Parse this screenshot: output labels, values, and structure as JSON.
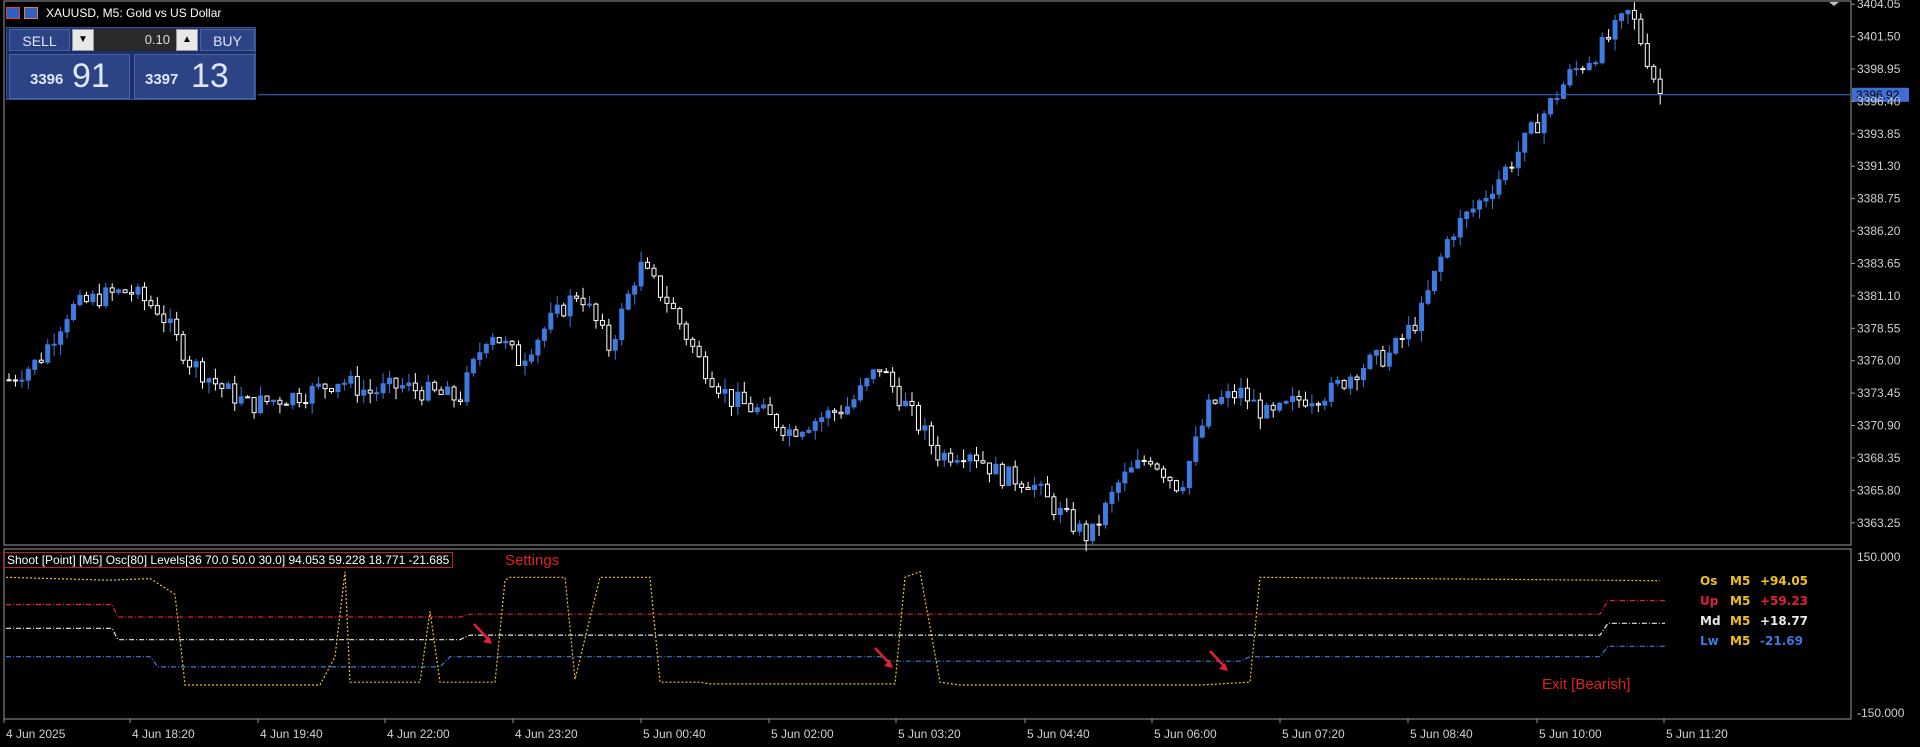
{
  "window": {
    "symbol_title": "XAUUSD, M5:  Gold vs US Dollar"
  },
  "trade_panel": {
    "sell_label": "SELL",
    "buy_label": "BUY",
    "lot_value": "0.10",
    "bid_small": "3396",
    "bid_big": "91",
    "ask_small": "3397",
    "ask_big": "13"
  },
  "colors": {
    "background": "#000000",
    "bull_candle": "#3d7be0",
    "bear_candle": "#ffffff",
    "current_price_line": "#3d6fd6",
    "osc": "#f0c020",
    "up": "#e0203c",
    "md": "#e8e8e8",
    "lw": "#3d7be0"
  },
  "indicator": {
    "label": "Shoot [Point] [M5]  Osc[80]  Levels[36 70.0 50.0 30.0] 94.053 59.228 18.771 -21.685",
    "settings_label": "Settings",
    "exit_label": "Exit [Bearish]",
    "legend": [
      {
        "name": "Os",
        "tf": "M5",
        "value": "+94.05",
        "color": "#f0c020"
      },
      {
        "name": "Up",
        "tf": "M5",
        "value": "+59.23",
        "color": "#e0203c"
      },
      {
        "name": "Md",
        "tf": "M5",
        "value": "+18.77",
        "color": "#e8e8e8"
      },
      {
        "name": "Lw",
        "tf": "M5",
        "value": "-21.69",
        "color": "#3d7be0"
      }
    ]
  },
  "chart_data": [
    {
      "type": "candlestick",
      "symbol": "XAUUSD",
      "timeframe": "M5",
      "y_ticks": [
        "3404.05",
        "3401.50",
        "3398.95",
        "3396.40",
        "3393.85",
        "3391.30",
        "3388.75",
        "3386.20",
        "3383.65",
        "3381.10",
        "3378.55",
        "3376.00",
        "3373.45",
        "3370.90",
        "3368.35",
        "3365.80",
        "3363.25"
      ],
      "ylim": [
        3361.5,
        3404.3
      ],
      "current_price": "3396.92",
      "x_ticks": [
        "4 Jun 2025",
        "4 Jun 18:20",
        "4 Jun 19:40",
        "4 Jun 22:00",
        "4 Jun 23:20",
        "5 Jun 00:40",
        "5 Jun 02:00",
        "5 Jun 03:20",
        "5 Jun 04:40",
        "5 Jun 06:00",
        "5 Jun 07:20",
        "5 Jun 08:40",
        "5 Jun 10:00",
        "5 Jun 11:20"
      ],
      "close_path": [
        3374.5,
        3376.0,
        3380.0,
        3381.0,
        3381.5,
        3380.0,
        3376.0,
        3374.0,
        3372.5,
        3373.0,
        3373.5,
        3374.5,
        3373.5,
        3374.0,
        3373.5,
        3373.0,
        3378.5,
        3376.0,
        3379.0,
        3381.5,
        3377.0,
        3383.5,
        3380.5,
        3376.0,
        3373.0,
        3372.0,
        3370.5,
        3371.5,
        3372.5,
        3375.5,
        3372.0,
        3368.5,
        3369.0,
        3367.0,
        3366.5,
        3364.0,
        3362.0,
        3366.5,
        3368.5,
        3366.0,
        3372.5,
        3373.5,
        3371.5,
        3373.0,
        3373.5,
        3375.5,
        3376.5,
        3379.5,
        3386.0,
        3388.5,
        3391.5,
        3395.0,
        3398.5,
        3400.5,
        3403.5,
        3397.0
      ]
    },
    {
      "type": "line",
      "name": "Shoot [Point] [M5]",
      "y_ticks": [
        "150.000",
        "-150.000"
      ],
      "ylim": [
        -150,
        150
      ],
      "levels": [
        70.0,
        50.0,
        30.0
      ],
      "series": [
        {
          "name": "Os",
          "last": 94.053
        },
        {
          "name": "Up",
          "last": 59.228
        },
        {
          "name": "Md",
          "last": 18.771
        },
        {
          "name": "Lw",
          "last": -21.685
        }
      ]
    }
  ]
}
